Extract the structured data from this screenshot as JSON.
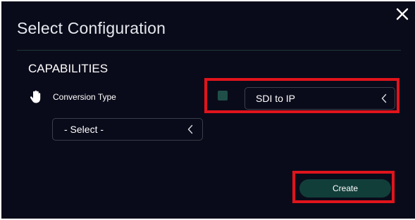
{
  "dialog": {
    "title": "Select Configuration",
    "close_icon": "close-icon"
  },
  "capabilities": {
    "heading": "CAPABILITIES",
    "row_icon": "hand-pointer-icon",
    "conversion_type_label": "Conversion Type",
    "conversion_select": {
      "value": "- Select -",
      "icon": "chevron-left-icon"
    },
    "enable_checkbox": {
      "checked": true
    },
    "mode_select": {
      "value": "SDI to IP",
      "icon": "chevron-left-icon"
    }
  },
  "actions": {
    "create_label": "Create"
  },
  "colors": {
    "background": "#0a0b1a",
    "accent": "#123e3a",
    "highlight": "#e0141c"
  }
}
